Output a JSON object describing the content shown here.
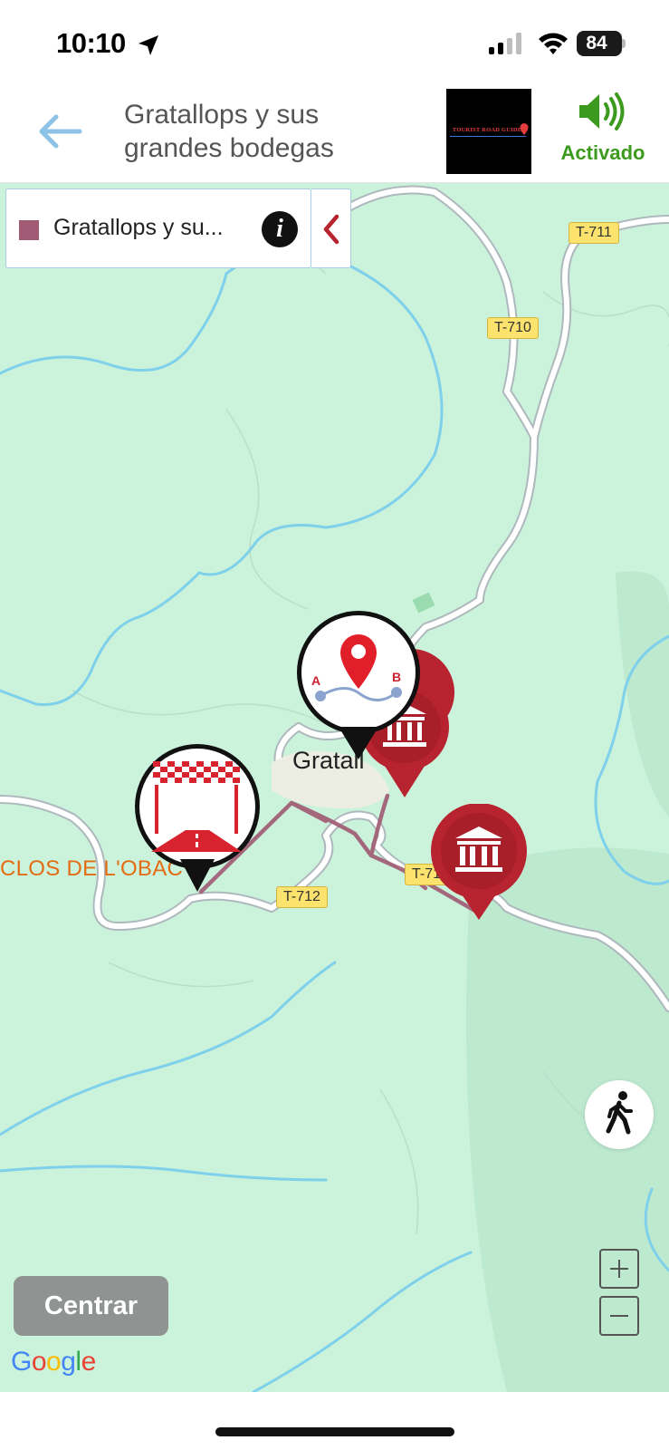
{
  "status_bar": {
    "time": "10:10",
    "battery": "84"
  },
  "header": {
    "title": "Gratallops y sus grandes bodegas",
    "logo_text": "TOURIST ROAD GUIDES",
    "sound_label": "Activado"
  },
  "legend": {
    "label": "Gratallops y su..."
  },
  "map": {
    "town": "Gratall",
    "poi": "CLOS DE L'OBAC",
    "roads": [
      "T-711",
      "T-710",
      "T-712",
      "T-710"
    ],
    "route_color": "#a05a73",
    "marker_color": "#b7232f",
    "land_color": "#cbf3dc",
    "water_color": "#7fd0ea"
  },
  "controls": {
    "center_label": "Centrar",
    "google_label": "Google",
    "zoom_in": "+",
    "zoom_out": "−"
  },
  "icons": [
    "location-arrow-icon",
    "signal-icon",
    "wifi-icon",
    "battery-icon",
    "back-arrow-icon",
    "speaker-icon",
    "info-icon",
    "chevron-left-icon",
    "museum-icon",
    "route-ab-icon",
    "finish-line-icon",
    "walking-person-icon"
  ]
}
